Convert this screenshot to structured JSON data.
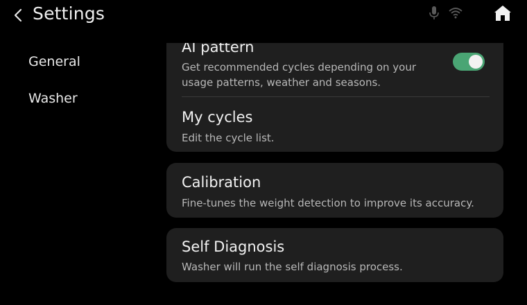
{
  "header": {
    "title": "Settings",
    "back_icon": "chevron-left-icon",
    "status_icons": [
      "microphone-icon",
      "wifi-icon"
    ],
    "home_icon": "home-icon"
  },
  "sidebar": {
    "items": [
      {
        "label": "General"
      },
      {
        "label": "Washer"
      }
    ]
  },
  "main": {
    "ai_pattern": {
      "title": "AI pattern",
      "description_line1": "Get recommended cycles depending on your",
      "description_line2": "usage patterns, weather and seasons.",
      "enabled": true
    },
    "my_cycles": {
      "title": "My cycles",
      "description": "Edit the cycle list."
    },
    "calibration": {
      "title": "Calibration",
      "description": "Fine-tunes the weight detection to improve its accuracy."
    },
    "self_diagnosis": {
      "title": "Self Diagnosis",
      "description": "Washer will run the self diagnosis process."
    }
  },
  "colors": {
    "background": "#000000",
    "card": "#1f1f1f",
    "toggle_on": "#4aa574"
  }
}
